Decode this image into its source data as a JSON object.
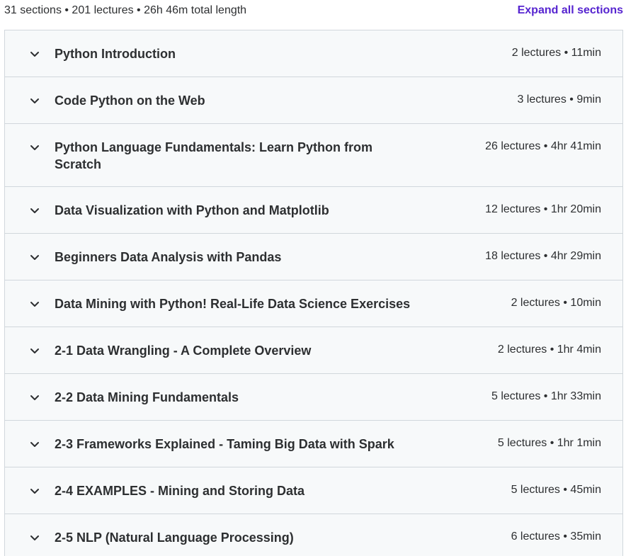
{
  "header": {
    "summary": "31 sections • 201 lectures • 26h 46m total length",
    "expand_label": "Expand all sections"
  },
  "sections": [
    {
      "title": "Python Introduction",
      "meta": "2 lectures • 11min"
    },
    {
      "title": "Code Python on the Web",
      "meta": "3 lectures • 9min"
    },
    {
      "title": "Python Language Fundamentals: Learn Python from Scratch",
      "meta": "26 lectures • 4hr 41min"
    },
    {
      "title": "Data Visualization with Python and Matplotlib",
      "meta": "12 lectures • 1hr 20min"
    },
    {
      "title": "Beginners Data Analysis with Pandas",
      "meta": "18 lectures • 4hr 29min"
    },
    {
      "title": "Data Mining with Python! Real-Life Data Science Exercises",
      "meta": "2 lectures • 10min"
    },
    {
      "title": "2-1 Data Wrangling - A Complete Overview",
      "meta": "2 lectures • 1hr 4min"
    },
    {
      "title": "2-2 Data Mining Fundamentals",
      "meta": "5 lectures • 1hr 33min"
    },
    {
      "title": "2-3 Frameworks Explained - Taming Big Data with Spark",
      "meta": "5 lectures • 1hr 1min"
    },
    {
      "title": "2-4 EXAMPLES - Mining and Storing Data",
      "meta": "5 lectures • 45min"
    },
    {
      "title": "2-5 NLP (Natural Language Processing)",
      "meta": "6 lectures • 35min"
    }
  ],
  "icons": {
    "section_toggle": "chevron-down-icon"
  },
  "colors": {
    "accent": "#5624d0",
    "row_background": "#f7f9fa",
    "border": "#d1d7dc",
    "text": "#2d2f31"
  }
}
